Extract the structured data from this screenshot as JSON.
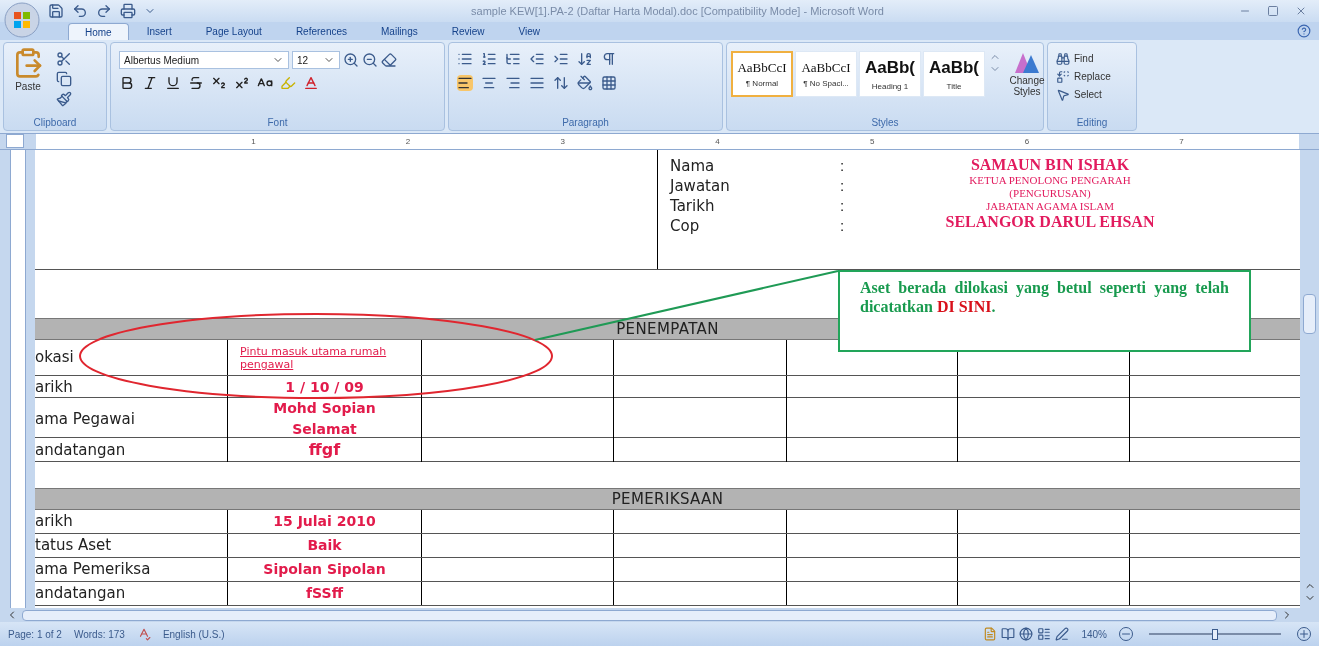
{
  "window": {
    "title": "sample KEW[1].PA-2 (Daftar Harta Modal).doc [Compatibility Mode] - Microsoft Word"
  },
  "tabs": [
    {
      "label": "Home",
      "selected": true
    },
    {
      "label": "Insert",
      "selected": false
    },
    {
      "label": "Page Layout",
      "selected": false
    },
    {
      "label": "References",
      "selected": false
    },
    {
      "label": "Mailings",
      "selected": false
    },
    {
      "label": "Review",
      "selected": false
    },
    {
      "label": "View",
      "selected": false
    }
  ],
  "ribbon": {
    "clipboard": {
      "paste": "Paste",
      "group": "Clipboard"
    },
    "font": {
      "name": "Albertus Medium",
      "size": "12",
      "group": "Font"
    },
    "paragraph": {
      "group": "Paragraph"
    },
    "styles": {
      "items": [
        {
          "preview": "AaBbCcI",
          "name": "¶ Normal",
          "kind": "body",
          "selected": true
        },
        {
          "preview": "AaBbCcI",
          "name": "¶ No Spaci...",
          "kind": "body",
          "selected": false
        },
        {
          "preview": "AaBb(",
          "name": "Heading 1",
          "kind": "heading",
          "selected": false
        },
        {
          "preview": "AaBb(",
          "name": "Title",
          "kind": "heading",
          "selected": false
        }
      ],
      "change": "Change Styles",
      "group": "Styles"
    },
    "editing": {
      "items": [
        {
          "label": "Find",
          "kind": "find"
        },
        {
          "label": "Replace",
          "kind": "replace"
        },
        {
          "label": "Select",
          "kind": "select"
        }
      ],
      "group": "Editing"
    }
  },
  "ruler": {
    "numbers": [
      "1",
      "2",
      "3",
      "4",
      "5",
      "6",
      "7"
    ]
  },
  "signature": {
    "rows": [
      {
        "label": "Nama",
        "colon": ":"
      },
      {
        "label": "Jawatan",
        "colon": ":"
      },
      {
        "label": "Tarikh",
        "colon": ":"
      },
      {
        "label": "Cop",
        "colon": ":"
      }
    ],
    "values": [
      {
        "text": "SAMAUN BIN ISHAK",
        "kind": "large"
      },
      {
        "text": "KETUA PENOLONG PENGARAH",
        "kind": "small"
      },
      {
        "text": "(PENGURUSAN)",
        "kind": "small"
      },
      {
        "text": "JABATAN AGAMA ISLAM",
        "kind": "small"
      },
      {
        "text": "SELANGOR DARUL EHSAN",
        "kind": "large"
      }
    ]
  },
  "sections": [
    {
      "title": "PENEMPATAN",
      "rows": [
        {
          "label": "okasi",
          "value": "Pintu masuk utama rumah pengawal",
          "kind": "note"
        },
        {
          "label": "arikh",
          "value": "1 / 10 / 09",
          "kind": "entry"
        },
        {
          "label": "ama Pegawai",
          "value": "Mohd Sopian Selamat",
          "kind": "entry"
        },
        {
          "label": "andatangan",
          "value": "ffgf",
          "kind": "sign"
        }
      ]
    },
    {
      "title": "PEMERIKSAAN",
      "rows": [
        {
          "label": "arikh",
          "value": "15 Julai 2010",
          "kind": "entry"
        },
        {
          "label": "tatus Aset",
          "value": "Baik",
          "kind": "entry"
        },
        {
          "label": "ama Pemeriksa",
          "value": "Sipolan Sipolan",
          "kind": "entry"
        },
        {
          "label": "andatangan",
          "value": "fSSff",
          "kind": "entry"
        }
      ]
    }
  ],
  "callout": {
    "text": "Aset berada dilokasi yang betul seperti yang telah dicatatkan",
    "highlight": "DI SINI",
    "end": "."
  },
  "status_bar": {
    "page": "Page: 1 of 2",
    "words": "Words: 173",
    "language": "English (U.S.)",
    "zoom": "140%",
    "zoom_slider": {
      "level": 0.5
    }
  }
}
